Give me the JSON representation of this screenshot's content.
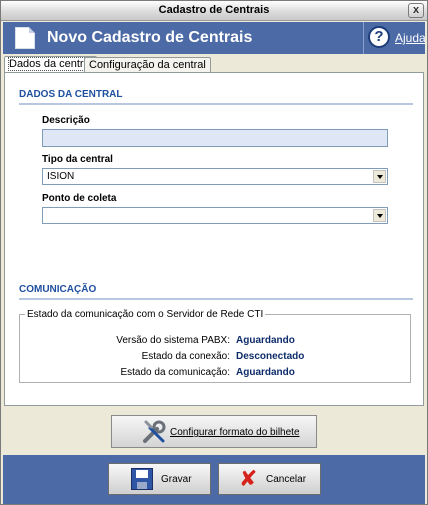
{
  "window": {
    "title": "Cadastro de Centrais",
    "close_glyph": "x"
  },
  "banner": {
    "title": "Novo Cadastro de Centrais",
    "help_label": "Ajuda",
    "help_glyph": "?"
  },
  "tabs": [
    {
      "label": "Dados da central",
      "active": true
    },
    {
      "label": "Configuração da central",
      "active": false
    }
  ],
  "dados": {
    "section_title": "DADOS DA CENTRAL",
    "descricao": {
      "label": "Descrição",
      "value": ""
    },
    "tipo": {
      "label": "Tipo da central",
      "value": "ISION"
    },
    "ponto": {
      "label": "Ponto de coleta",
      "value": ""
    }
  },
  "comunicacao": {
    "section_title": "COMUNICAÇÃO",
    "group_title": "Estado da comunicação com o Servidor de Rede CTI",
    "rows": [
      {
        "label": "Versão do sistema PABX:",
        "value": "Aguardando"
      },
      {
        "label": "Estado da conexão:",
        "value": "Desconectado"
      },
      {
        "label": "Estado da comunicação:",
        "value": "Aguardando"
      }
    ]
  },
  "buttons": {
    "config_label": "Configurar formato do bilhete",
    "save_label": "Gravar",
    "cancel_label": "Cancelar",
    "cancel_glyph": "✘"
  },
  "colors": {
    "banner": "#4c6aa6",
    "section_title": "#1f4f9f",
    "status_value": "#0e2c6a"
  }
}
